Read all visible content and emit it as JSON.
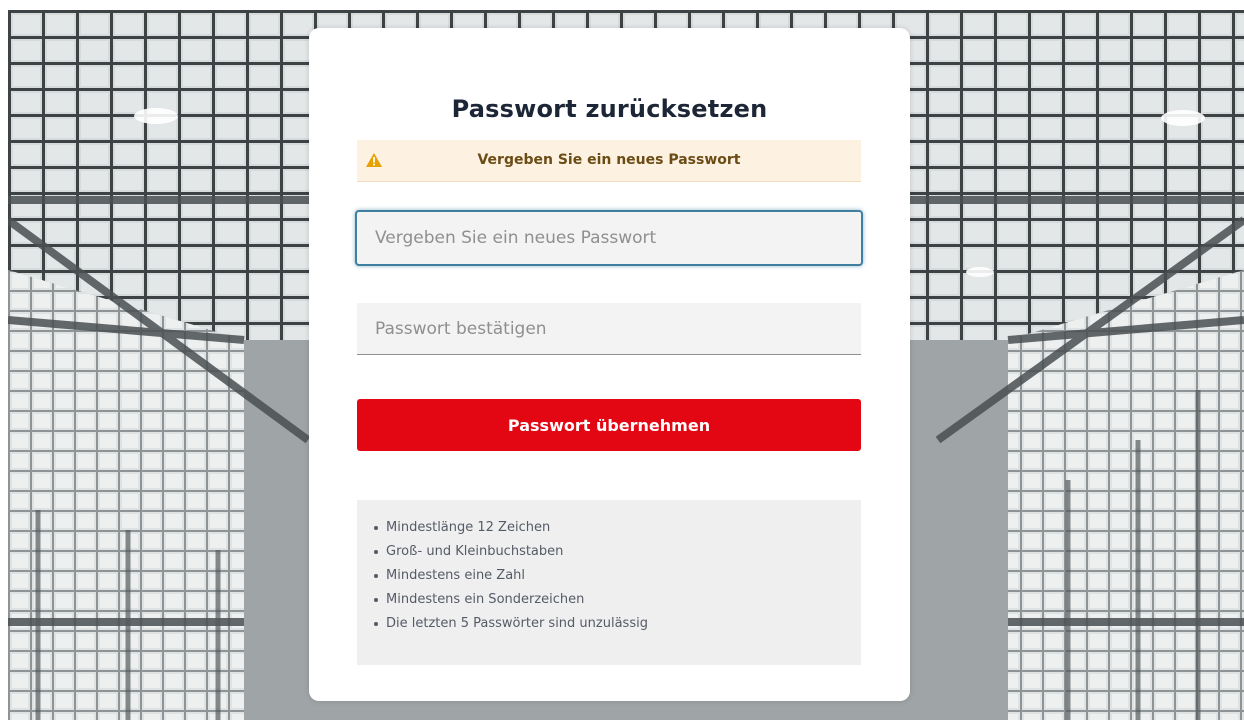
{
  "page": {
    "title": "Passwort zurücksetzen"
  },
  "alert": {
    "icon": "warning-icon",
    "text": "Vergeben Sie ein neues Passwort",
    "color": "#fdf1e2"
  },
  "form": {
    "new_password": {
      "value": "",
      "placeholder": "Vergeben Sie ein neues Passwort"
    },
    "confirm_password": {
      "value": "",
      "placeholder": "Passwort bestätigen"
    },
    "submit_label": "Passwort übernehmen",
    "submit_color": "#e30613"
  },
  "rules": {
    "items": [
      "Mindestlänge 12 Zeichen",
      "Groß- und Kleinbuchstaben",
      "Mindestens eine Zahl",
      "Mindestens ein Sonderzeichen",
      "Die letzten 5 Passwörter sind unzulässig"
    ]
  }
}
